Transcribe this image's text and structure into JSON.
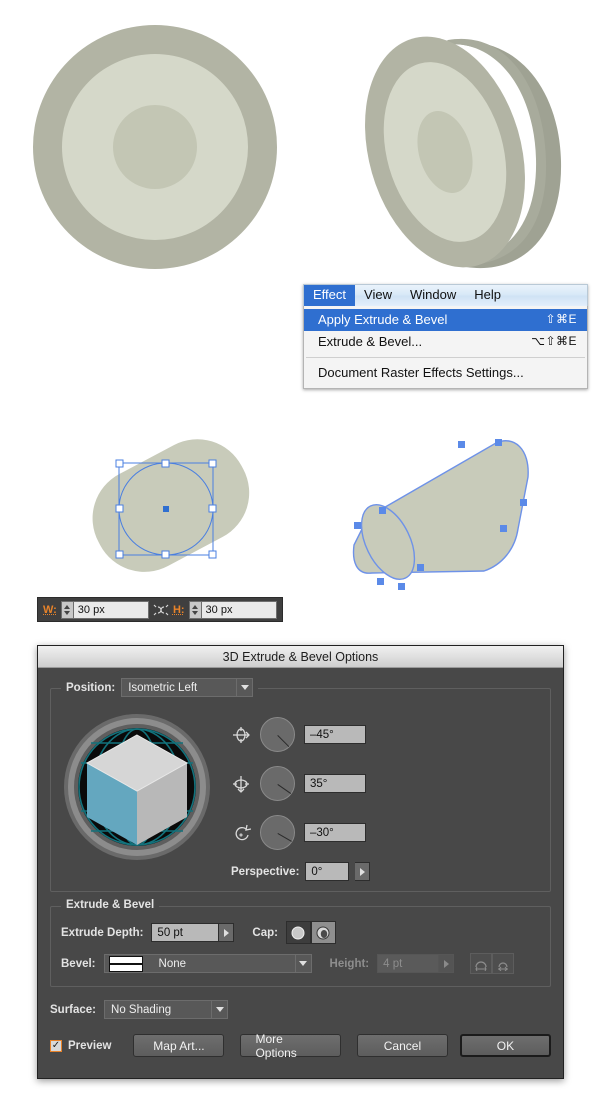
{
  "menu": {
    "bar_items": [
      {
        "label": "Effect",
        "active": true
      },
      {
        "label": "View",
        "active": false
      },
      {
        "label": "Window",
        "active": false
      },
      {
        "label": "Help",
        "active": false
      }
    ],
    "items": [
      {
        "label": "Apply Extrude & Bevel",
        "shortcut": "⇧⌘E",
        "selected": true
      },
      {
        "label": "Extrude & Bevel...",
        "shortcut": "⌥⇧⌘E",
        "selected": false
      },
      {
        "label": "Document Raster Effects Settings...",
        "shortcut": "",
        "selected": false
      }
    ]
  },
  "toolbar": {
    "width_label": "W:",
    "width_value": "30 px",
    "height_label": "H:",
    "height_value": "30 px",
    "link_icon": "chain-link-icon"
  },
  "dialog": {
    "title": "3D Extrude & Bevel Options",
    "position_label": "Position:",
    "position_value": "Isometric Left",
    "rotate_x_icon": "rotate-x-axis-icon",
    "rotate_y_icon": "rotate-y-axis-icon",
    "rotate_z_icon": "rotate-z-axis-icon",
    "rotate_x_value": "–45°",
    "rotate_y_value": "35°",
    "rotate_z_value": "–30°",
    "perspective_label": "Perspective:",
    "perspective_value": "0°",
    "extrude_group_label": "Extrude & Bevel",
    "extrude_depth_label": "Extrude Depth:",
    "extrude_depth_value": "50 pt",
    "cap_label": "Cap:",
    "cap_solid_icon": "cap-solid-icon",
    "cap_hollow_icon": "cap-hollow-icon",
    "bevel_label": "Bevel:",
    "bevel_value": "None",
    "height_label": "Height:",
    "height_value": "4 pt",
    "bevel_extent_out_icon": "bevel-extent-out-icon",
    "bevel_extent_in_icon": "bevel-extent-in-icon",
    "surface_label": "Surface:",
    "surface_value": "No Shading",
    "preview_label": "Preview",
    "preview_checked": true,
    "map_art_label": "Map Art...",
    "more_options_label": "More Options",
    "cancel_label": "Cancel",
    "ok_label": "OK"
  },
  "colors": {
    "accent_blue": "#2f6fd0",
    "cube_left_face": "#64a7bf",
    "cube_top_face": "#d6d6d6",
    "cube_right_face": "#b8b8b8",
    "globe_wire": "#0f6b74",
    "art_outer": "#b2b4a4",
    "art_mid": "#d5d8c9",
    "art_inner": "#c3c6b4",
    "selection_blue": "#4a7fe0",
    "orange_label": "#e8832a",
    "dialog_bg": "#484848"
  },
  "artwork": {
    "flat_disc_name": "flat-concentric-disc",
    "extruded_disc_name": "extruded-3d-disc",
    "selected_circle_name": "selected-circle-with-bounding-box",
    "extruded_cylinder_name": "extruded-3d-cylinder"
  }
}
